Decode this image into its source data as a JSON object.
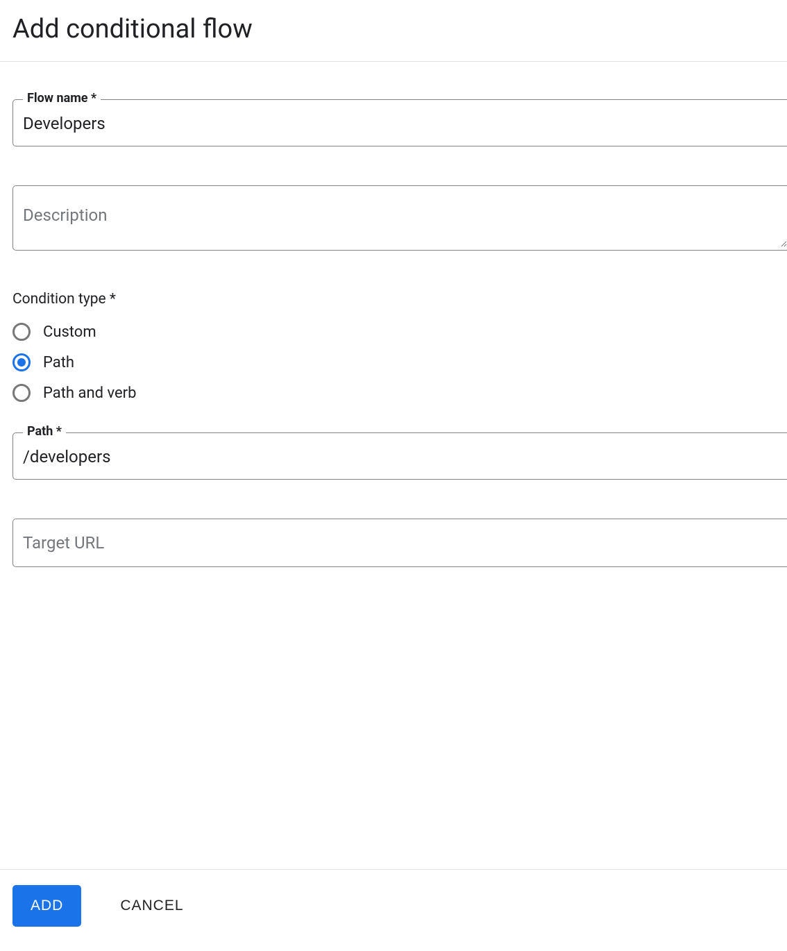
{
  "header": {
    "title": "Add conditional flow"
  },
  "form": {
    "flow_name": {
      "label": "Flow name *",
      "value": "Developers"
    },
    "description": {
      "placeholder": "Description",
      "value": ""
    },
    "condition_type": {
      "label": "Condition type *",
      "options": [
        {
          "label": "Custom",
          "selected": false
        },
        {
          "label": "Path",
          "selected": true
        },
        {
          "label": "Path and verb",
          "selected": false
        }
      ]
    },
    "path": {
      "label": "Path *",
      "value": "/developers"
    },
    "target_url": {
      "placeholder": "Target URL",
      "value": ""
    }
  },
  "footer": {
    "add_label": "ADD",
    "cancel_label": "CANCEL"
  }
}
